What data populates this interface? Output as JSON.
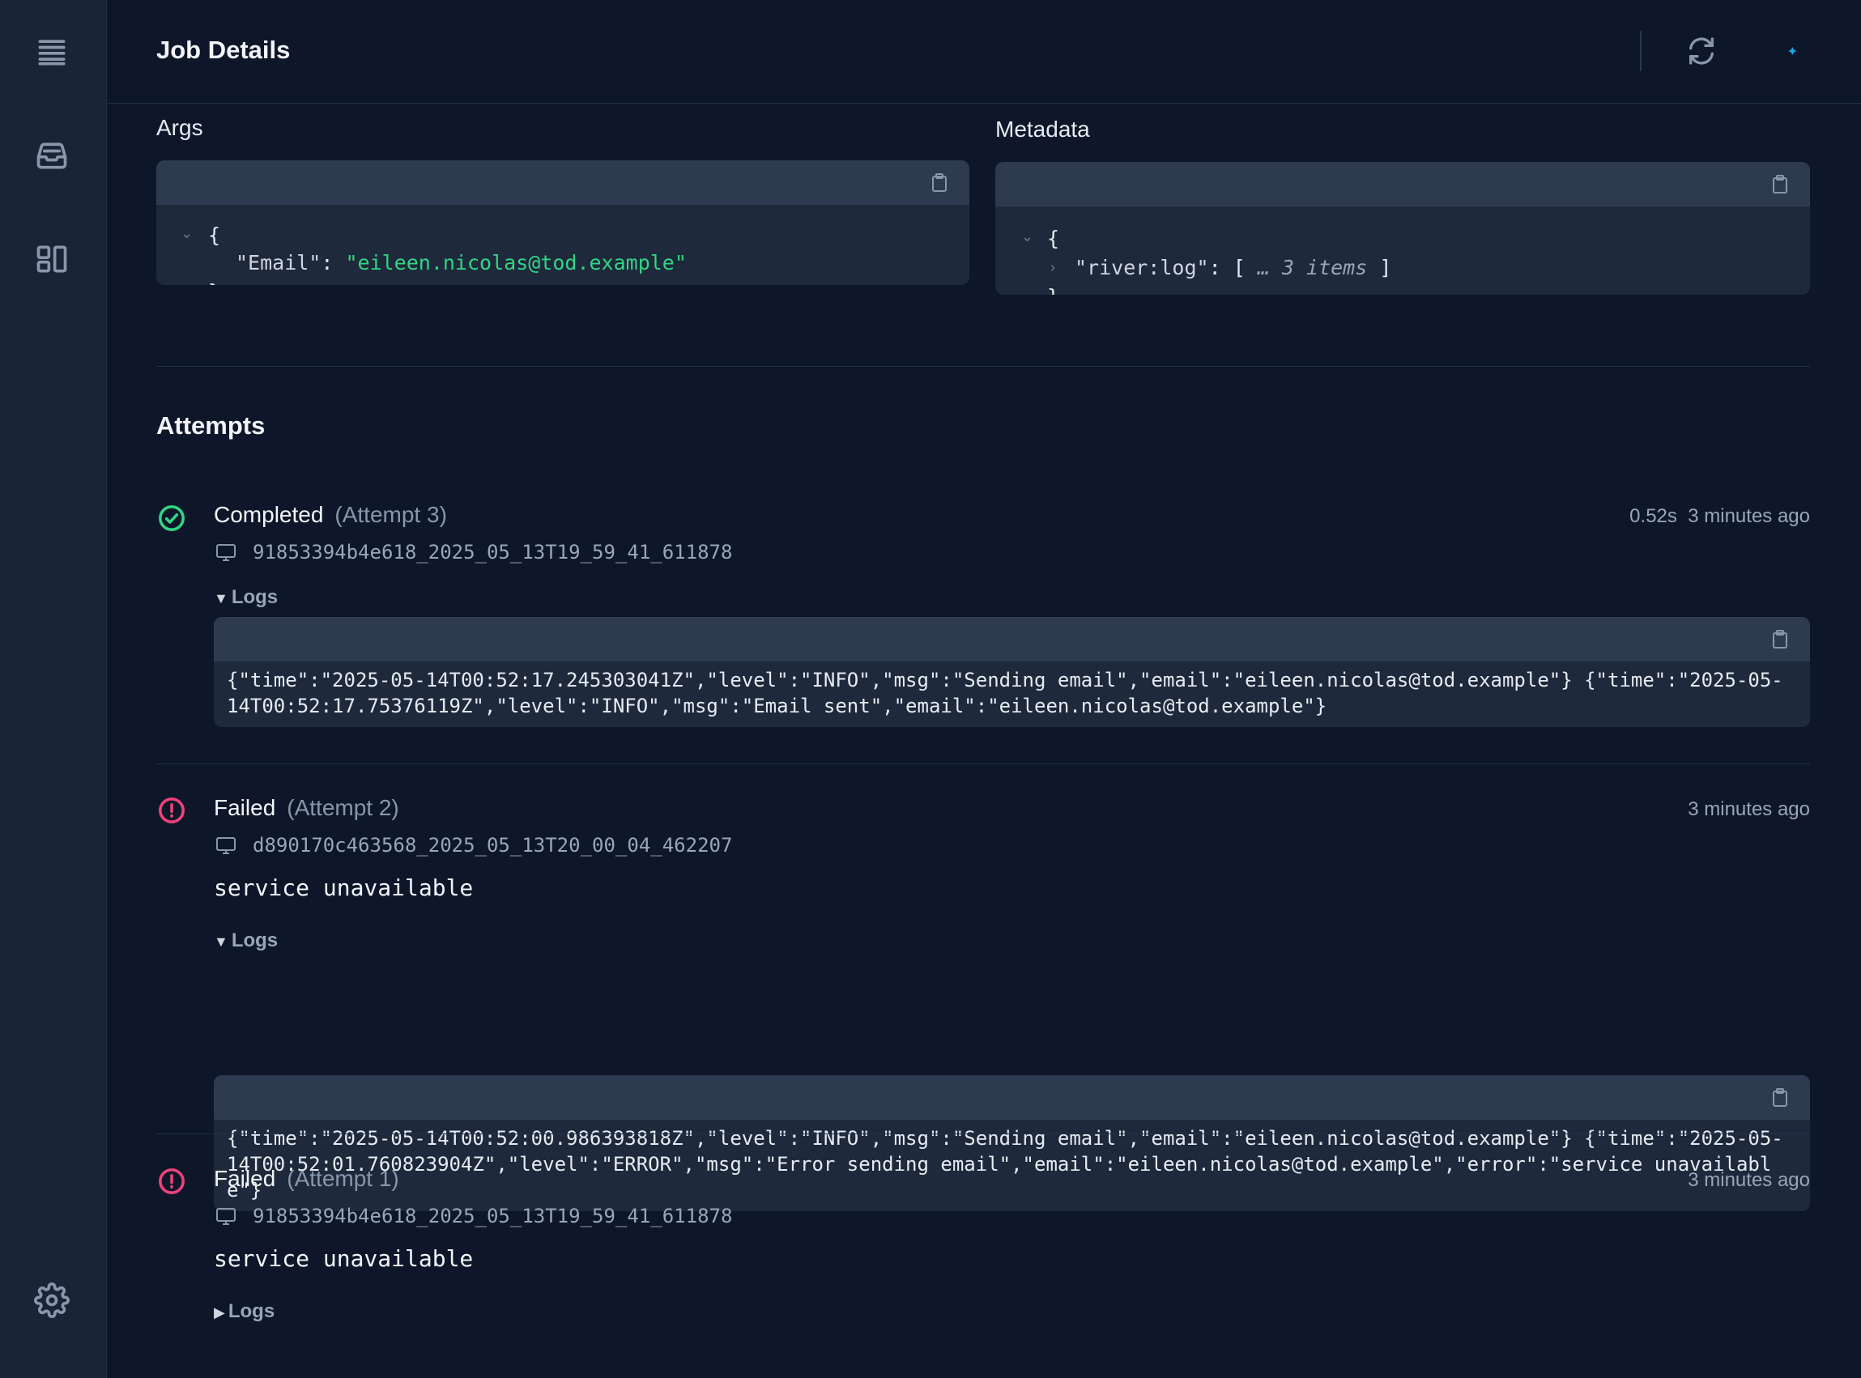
{
  "header": {
    "title": "Job Details"
  },
  "args": {
    "label": "Args",
    "open": "{",
    "key": "\"Email\"",
    "sep": ": ",
    "value": "\"eileen.nicolas@tod.example\"",
    "close": "}"
  },
  "metadata": {
    "label": "Metadata",
    "open": "{",
    "key": "\"river:log\"",
    "sep": ": ",
    "bracket_open": "[",
    "items_text": "… 3 items",
    "bracket_close": "]",
    "close": "}"
  },
  "attempts": {
    "title": "Attempts",
    "list": [
      {
        "status": "Completed",
        "attempt": "(Attempt 3)",
        "duration": "0.52s",
        "time_ago": "3 minutes ago",
        "host": "91853394b4e618_2025_05_13T19_59_41_611878",
        "logs_label": "Logs",
        "logs": "{\"time\":\"2025-05-14T00:52:17.245303041Z\",\"level\":\"INFO\",\"msg\":\"Sending email\",\"email\":\"eileen.nicolas@tod.example\"} {\"time\":\"2025-05-14T00:52:17.75376119Z\",\"level\":\"INFO\",\"msg\":\"Email sent\",\"email\":\"eileen.nicolas@tod.example\"}"
      },
      {
        "status": "Failed",
        "attempt": "(Attempt 2)",
        "time_ago": "3 minutes ago",
        "host": "d890170c463568_2025_05_13T20_00_04_462207",
        "error": "service unavailable",
        "logs_label": "Logs",
        "logs": "{\"time\":\"2025-05-14T00:52:00.986393818Z\",\"level\":\"INFO\",\"msg\":\"Sending email\",\"email\":\"eileen.nicolas@tod.example\"} {\"time\":\"2025-05-14T00:52:01.760823904Z\",\"level\":\"ERROR\",\"msg\":\"Error sending email\",\"email\":\"eileen.nicolas@tod.example\",\"error\":\"service unavailable\"}"
      },
      {
        "status": "Failed",
        "attempt": "(Attempt 1)",
        "time_ago": "3 minutes ago",
        "host": "91853394b4e618_2025_05_13T19_59_41_611878",
        "error": "service unavailable",
        "logs_label": "Logs"
      }
    ]
  },
  "icons": {
    "sidebar": [
      "list-icon",
      "inbox-icon",
      "queues-icon",
      "settings-icon"
    ],
    "header": [
      "refresh-icon",
      "live-update-icon"
    ]
  },
  "colors": {
    "background": "#0e1729",
    "sidebar": "#1a2437",
    "success": "#32d583",
    "error": "#f0427a",
    "accent": "#1ca3f5"
  }
}
